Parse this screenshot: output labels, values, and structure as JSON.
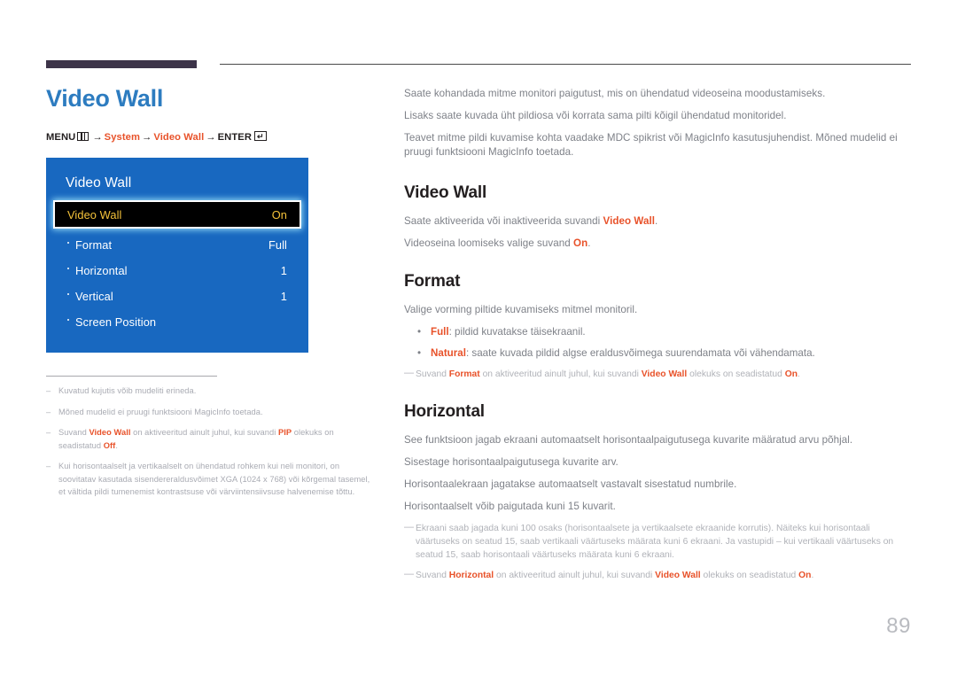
{
  "page": {
    "title": "Video Wall",
    "number": "89",
    "accent_color": "#e8522a",
    "title_color": "#2d7cc0",
    "rule_color": "#3d3449"
  },
  "menu_path": {
    "prefix": "MENU",
    "menu_icon": "menu-icon",
    "step1": "System",
    "step2": "Video Wall",
    "enter_label": "ENTER",
    "enter_icon": "enter-key-icon",
    "arrow": "→"
  },
  "osd": {
    "title": "Video Wall",
    "rows": [
      {
        "label": "Video Wall",
        "value": "On",
        "selected": true,
        "bulleted": false
      },
      {
        "label": "Format",
        "value": "Full",
        "selected": false,
        "bulleted": true
      },
      {
        "label": "Horizontal",
        "value": "1",
        "selected": false,
        "bulleted": true
      },
      {
        "label": "Vertical",
        "value": "1",
        "selected": false,
        "bulleted": true
      },
      {
        "label": "Screen Position",
        "value": "",
        "selected": false,
        "bulleted": true
      }
    ]
  },
  "left_footnotes": [
    {
      "dash": "–",
      "html": "Kuvatud kujutis võib mudeliti erineda."
    },
    {
      "dash": "–",
      "html": "Mõned mudelid ei pruugi funktsiooni MagicInfo toetada."
    },
    {
      "dash": "–",
      "html": "Suvand <b>Video Wall</b> on aktiveeritud ainult juhul, kui suvandi <b>PIP</b> olekuks on seadistatud <b>Off</b>."
    },
    {
      "dash": "–",
      "html": "Kui horisontaalselt ja vertikaalselt on ühendatud rohkem kui neli monitori, on soovitatav kasutada sisendereraldusvõimet XGA (1024 x 768) või kõrgemal tasemel, et vältida pildi tumenemist kontrastsuse või värviintensiivsuse halvenemise tõttu."
    }
  ],
  "right": {
    "intro": [
      "Saate kohandada mitme monitori paigutust, mis on ühendatud videoseina moodustamiseks.",
      "Lisaks saate kuvada üht pildiosa või korrata sama pilti kõigil ühendatud monitoridel.",
      "Teavet mitme pildi kuvamise kohta vaadake MDC spikrist või MagicInfo kasutusjuhendist. Mõned mudelid ei pruugi funktsiooni MagicInfo toetada."
    ],
    "sections": [
      {
        "heading": "Video Wall",
        "paragraphs": [
          "Saate aktiveerida või inaktiveerida suvandi <b>Video Wall</b>.",
          "Videoseina loomiseks valige suvand <b>On</b>."
        ],
        "bullets": [],
        "notes": []
      },
      {
        "heading": "Format",
        "paragraphs": [
          "Valige vorming piltide kuvamiseks mitmel monitoril."
        ],
        "bullets": [
          "<b>Full</b>: pildid kuvatakse täisekraanil.",
          "<b>Natural</b>: saate kuvada pildid algse eraldusvõimega suurendamata või vähendamata."
        ],
        "notes": [
          "Suvand <b>Format</b> on aktiveeritud ainult juhul, kui suvandi <b>Video Wall</b> olekuks on seadistatud <b>On</b>."
        ]
      },
      {
        "heading": "Horizontal",
        "paragraphs": [
          "See funktsioon jagab ekraani automaatselt horisontaalpaigutusega kuvarite määratud arvu põhjal.",
          "Sisestage horisontaalpaigutusega kuvarite arv.",
          "Horisontaalekraan jagatakse automaatselt vastavalt sisestatud numbrile.",
          "Horisontaalselt võib paigutada kuni 15 kuvarit."
        ],
        "bullets": [],
        "notes": [
          "Ekraani saab jagada kuni 100 osaks (horisontaalsete ja vertikaalsete ekraanide korrutis). Näiteks kui horisontaali väärtuseks on seatud 15, saab vertikaali väärtuseks määrata kuni 6 ekraani. Ja vastupidi – kui vertikaali väärtuseks on seatud 15, saab horisontaali väärtuseks määrata kuni 6 ekraani.",
          "Suvand <b>Horizontal</b> on aktiveeritud ainult juhul, kui suvandi <b>Video Wall</b> olekuks on seadistatud <b>On</b>."
        ]
      }
    ]
  }
}
